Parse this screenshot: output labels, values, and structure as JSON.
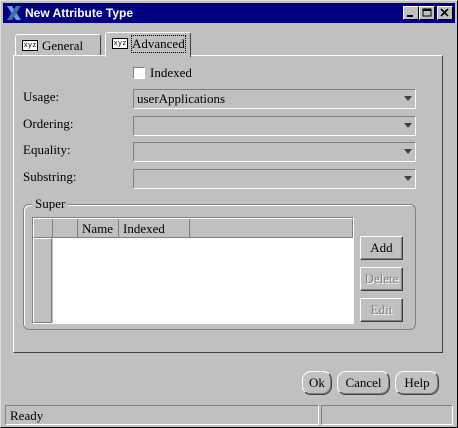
{
  "window": {
    "title": "New Attribute Type"
  },
  "tabs": [
    {
      "label": "General",
      "icon": "xyz-icon"
    },
    {
      "label": "Advanced",
      "icon": "xyz-icon",
      "active": true
    }
  ],
  "form": {
    "indexed_label": "Indexed",
    "indexed_checked": false,
    "usage_label": "Usage:",
    "usage_value": "userApplications",
    "ordering_label": "Ordering:",
    "ordering_value": "",
    "equality_label": "Equality:",
    "equality_value": "",
    "substring_label": "Substring:",
    "substring_value": ""
  },
  "super_group": {
    "legend": "Super",
    "columns": [
      "Name",
      "Indexed"
    ],
    "rows": [],
    "buttons": {
      "add": "Add",
      "delete": "Delete",
      "edit": "Edit"
    }
  },
  "footer": {
    "ok": "Ok",
    "cancel": "Cancel",
    "help": "Help"
  },
  "status": {
    "text": "Ready"
  }
}
